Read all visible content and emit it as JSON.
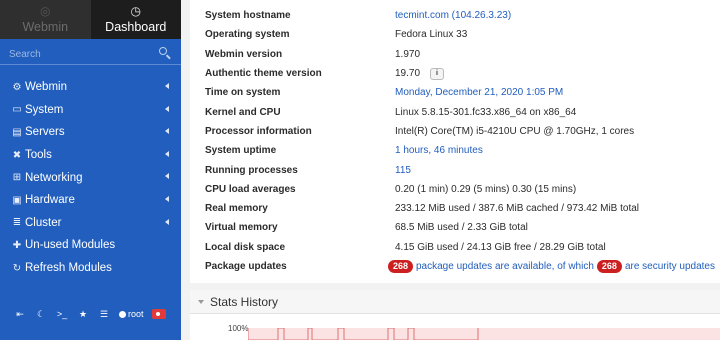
{
  "sidebar": {
    "tabs": [
      {
        "label": "Webmin",
        "icon": "webmin-logo-icon",
        "active": false
      },
      {
        "label": "Dashboard",
        "icon": "dashboard-gauge-icon",
        "active": true
      }
    ],
    "search": {
      "placeholder": "Search"
    },
    "menu": [
      {
        "label": "Webmin",
        "icon": "gear-icon",
        "glyph": "⚙"
      },
      {
        "label": "System",
        "icon": "computer-icon",
        "glyph": "▭"
      },
      {
        "label": "Servers",
        "icon": "server-icon",
        "glyph": "▤"
      },
      {
        "label": "Tools",
        "icon": "tools-icon",
        "glyph": "✖"
      },
      {
        "label": "Networking",
        "icon": "network-icon",
        "glyph": "⊞"
      },
      {
        "label": "Hardware",
        "icon": "hardware-icon",
        "glyph": "▣"
      },
      {
        "label": "Cluster",
        "icon": "cluster-icon",
        "glyph": "≣"
      },
      {
        "label": "Un-used Modules",
        "icon": "puzzle-icon",
        "glyph": "✚"
      },
      {
        "label": "Refresh Modules",
        "icon": "refresh-icon",
        "glyph": "↻"
      }
    ],
    "bottom_bar": {
      "user_label": "root",
      "buttons": [
        {
          "name": "toggle-frame-icon",
          "glyph": "⇤"
        },
        {
          "name": "night-mode-icon",
          "glyph": "☾"
        },
        {
          "name": "terminal-icon",
          "glyph": ">_"
        },
        {
          "name": "favorites-star-icon",
          "glyph": "★"
        },
        {
          "name": "theme-settings-icon",
          "glyph": "☰"
        }
      ]
    }
  },
  "system_info": {
    "rows": [
      {
        "label": "System hostname",
        "value": "tecmint.com (104.26.3.23)",
        "is_link": true
      },
      {
        "label": "Operating system",
        "value": "Fedora Linux 33",
        "is_link": false
      },
      {
        "label": "Webmin version",
        "value": "1.970",
        "is_link": false
      },
      {
        "label": "Authentic theme version",
        "value": "19.70",
        "is_link": false
      },
      {
        "label": "Time on system",
        "value": "Monday, December 21, 2020 1:05 PM",
        "is_link": true
      },
      {
        "label": "Kernel and CPU",
        "value": "Linux 5.8.15-301.fc33.x86_64 on x86_64",
        "is_link": false
      },
      {
        "label": "Processor information",
        "value": "Intel(R) Core(TM) i5-4210U CPU @ 1.70GHz, 1 cores",
        "is_link": false
      },
      {
        "label": "System uptime",
        "value": "1 hours, 46 minutes",
        "is_link": true
      },
      {
        "label": "Running processes",
        "value": "115",
        "is_link": true
      },
      {
        "label": "CPU load averages",
        "value": "0.20 (1 min) 0.29 (5 mins) 0.30 (15 mins)",
        "is_link": false
      },
      {
        "label": "Real memory",
        "value": "233.12 MiB used / 387.6 MiB cached / 973.42 MiB total",
        "is_link": false
      },
      {
        "label": "Virtual memory",
        "value": "68.5 MiB used / 2.33 GiB total",
        "is_link": false
      },
      {
        "label": "Local disk space",
        "value": "4.15 GiB used / 24.13 GiB free / 28.29 GiB total",
        "is_link": false
      }
    ],
    "package_updates": {
      "label": "Package updates",
      "count": "268",
      "text_mid": "package updates are available, of which",
      "security_count": "268",
      "text_end": "are security updates"
    },
    "theme_info_button": {
      "glyph": "i",
      "icon": "info-icon"
    }
  },
  "stats_history": {
    "title": "Stats History",
    "y_tick": "100%",
    "colors": {
      "line": "#e07070",
      "fill": "#fbe3e3"
    }
  },
  "colors": {
    "sidebar": "#215ebd",
    "link": "#215ebd",
    "badge": "#cc2020"
  }
}
